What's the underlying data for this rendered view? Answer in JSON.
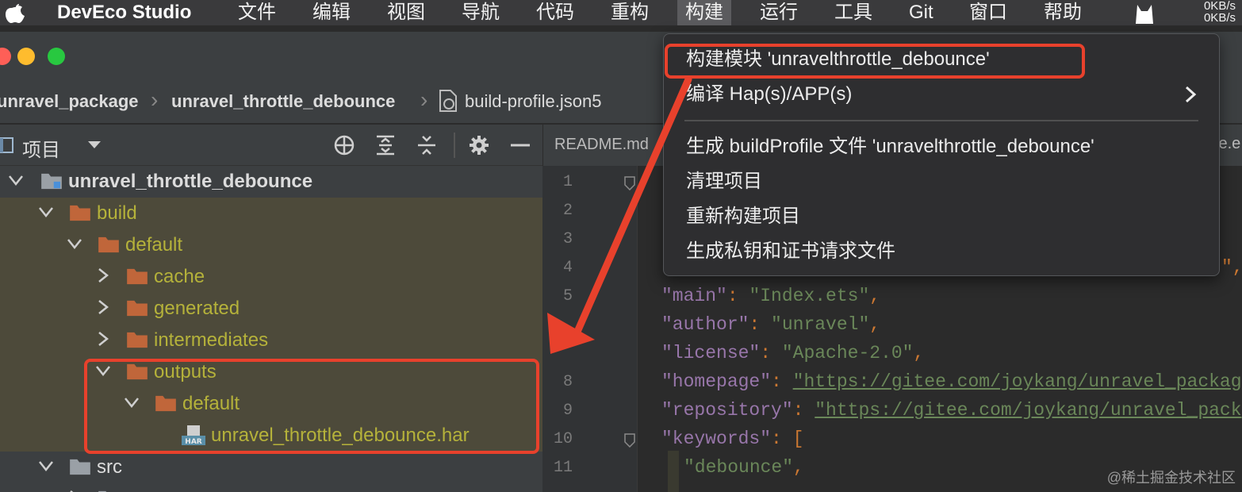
{
  "menubar": {
    "app_name": "DevEco Studio",
    "items": [
      "文件",
      "编辑",
      "视图",
      "导航",
      "代码",
      "重构",
      "构建",
      "运行",
      "工具",
      "Git",
      "窗口",
      "帮助"
    ],
    "active_item": "构建",
    "net_up": "0KB/s",
    "net_down": "0KB/s"
  },
  "breadcrumb": {
    "items": [
      "unravel_package",
      "unravel_throttle_debounce",
      "build-profile.json5"
    ]
  },
  "project_panel": {
    "title": "项目",
    "tree": [
      {
        "label": "unravel_throttle_debounce",
        "style": "bold"
      },
      {
        "label": "build",
        "style": "yellow"
      },
      {
        "label": "default",
        "style": "yellow"
      },
      {
        "label": "cache",
        "style": "yellow"
      },
      {
        "label": "generated",
        "style": "yellow"
      },
      {
        "label": "intermediates",
        "style": "yellow"
      },
      {
        "label": "outputs",
        "style": "yellow"
      },
      {
        "label": "default",
        "style": "yellow"
      },
      {
        "label": "unravel_throttle_debounce.har",
        "style": "yellow"
      },
      {
        "label": "src",
        "style": "white"
      }
    ]
  },
  "editor": {
    "tab_label": "README.md",
    "tab_right_fragment": "le.e",
    "line_numbers": [
      "1",
      "2",
      "3",
      "4",
      "5",
      "8",
      "9",
      "10",
      "11"
    ],
    "code_lines": [
      {
        "key": "\"main\"",
        "value": "\"Index.ets\"",
        "tail": ","
      },
      {
        "key": "\"author\"",
        "value": "\"unravel\"",
        "tail": ","
      },
      {
        "key": "\"license\"",
        "value": "\"Apache-2.0\"",
        "tail": ","
      },
      {
        "key": "\"homepage\"",
        "value": "\"https://gitee.com/joykang/unravel_packag",
        "tail": ""
      },
      {
        "key": "\"repository\"",
        "value": "\"https://gitee.com/joykang/unravel_pack",
        "tail": ""
      },
      {
        "key": "\"keywords\"",
        "value": "[",
        "tail": ""
      },
      {
        "key": "",
        "value": "\"debounce\"",
        "tail": ","
      }
    ],
    "trailing_comma": "\","
  },
  "dropdown": {
    "items": [
      "构建模块 'unravelthrottle_debounce'",
      "编译 Hap(s)/APP(s)",
      "生成 buildProfile 文件 'unravelthrottle_debounce'",
      "清理项目",
      "重新构建项目",
      "生成私钥和证书请求文件"
    ]
  },
  "watermark": "@稀土掘金技术社区",
  "colors": {
    "annotation_red": "#e8412c",
    "excluded_folder_text": "#b5b23a",
    "folder_icon": "#c0663a"
  }
}
